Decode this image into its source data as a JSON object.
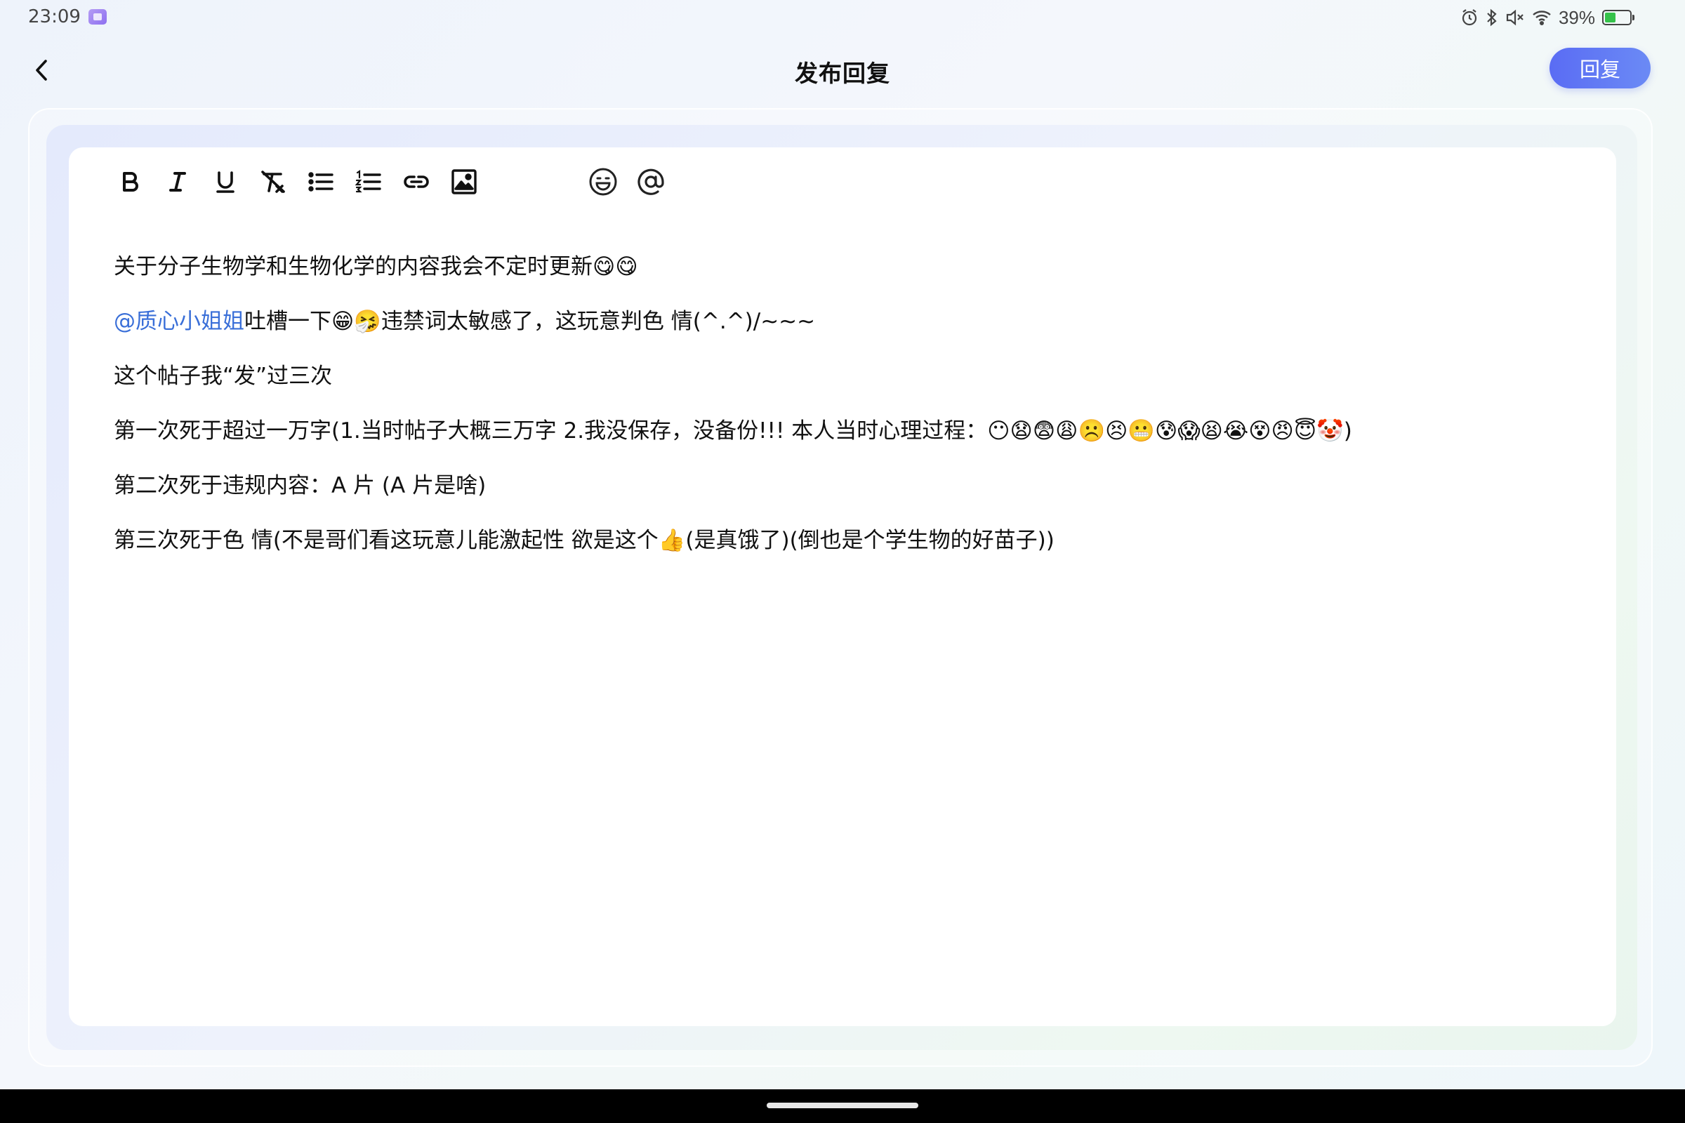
{
  "status_bar": {
    "time": "23:09",
    "battery_percent": "39%",
    "battery_level": 0.39,
    "icons": [
      "alarm-icon",
      "bluetooth-icon",
      "mute-icon",
      "wifi-icon",
      "battery-icon"
    ]
  },
  "header": {
    "back_icon": "chevron-left-icon",
    "title": "发布回复",
    "reply_label": "回复"
  },
  "colors": {
    "accent": "#5a6cf4",
    "mention": "#3a6fd8"
  },
  "toolbar": {
    "tools": [
      "bold-icon",
      "italic-icon",
      "underline-icon",
      "clear-format-icon",
      "bullet-list-icon",
      "numbered-list-icon",
      "link-icon",
      "image-icon",
      "emoji-icon",
      "at-mention-icon"
    ]
  },
  "content": {
    "line1": "关于分子生物学和生物化学的内容我会不定时更新😋😋",
    "line2_mention": "@质心小姐姐",
    "line2_rest": "吐槽一下😁🤧违禁词太敏感了，这玩意判色 情(^.^)/~~~",
    "line3": "这个帖子我“发”过三次",
    "line4": "第一次死于超过一万字(1.当时帖子大概三万字    2.我没保存，没备份!!!  本人当时心理过程：😶😧😨😩☹️😣😬😰😱😫😭😵😠😇🤡)",
    "line5": "第二次死于违规内容：A 片 (A 片是啥)",
    "line6": "第三次死于色 情(不是哥们看这玩意儿能激起性 欲是这个👍(是真饿了)(倒也是个学生物的好苗子))"
  }
}
